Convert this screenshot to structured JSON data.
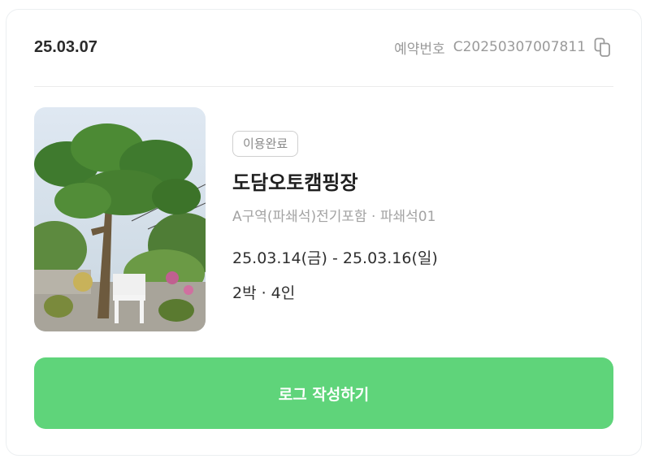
{
  "booking": {
    "date": "25.03.07",
    "reservation_label": "예약번호",
    "reservation_number": "C20250307007811"
  },
  "icons": {
    "copy": "copy-icon"
  },
  "thumbnail": {
    "alt": "campsite-photo"
  },
  "detail": {
    "status_badge": "이용완료",
    "campsite_name": "도담오토캠핑장",
    "site_name": "A구역(파쇄석)전기포함 · 파쇄석01",
    "period": "25.03.14(금) - 25.03.16(일)",
    "guests": "2박 · 4인"
  },
  "actions": {
    "write_log_label": "로그 작성하기"
  },
  "colors": {
    "accent": "#5fd47a",
    "text_primary": "#1f1f1f",
    "text_muted": "#9a9a9a"
  }
}
